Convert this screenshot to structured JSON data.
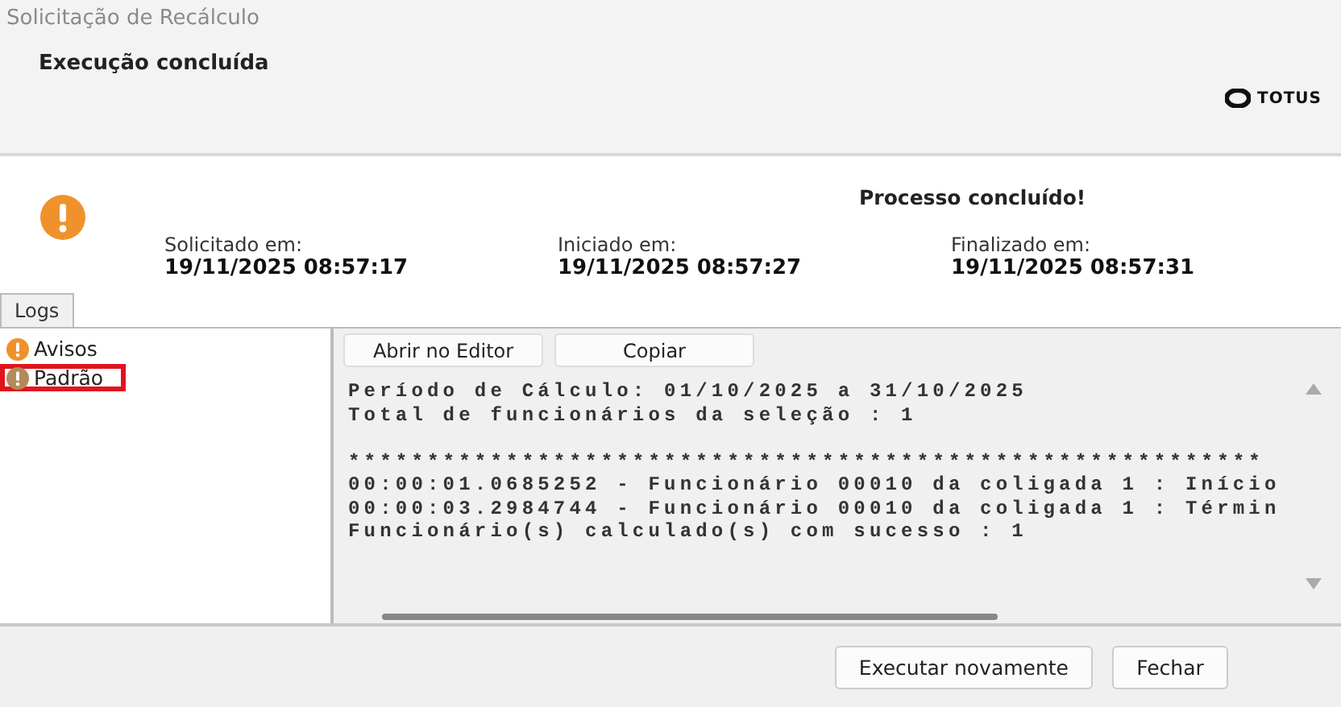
{
  "window": {
    "title": "Solicitação de Recálculo"
  },
  "header": {
    "heading": "Execução concluída",
    "logo": "TOTUS"
  },
  "summary": {
    "status": "Processo concluído!",
    "fields": [
      {
        "label": "Solicitado em:",
        "value": "19/11/2025 08:57:17"
      },
      {
        "label": "Iniciado em:",
        "value": "19/11/2025 08:57:27"
      },
      {
        "label": "Finalizado em:",
        "value": "19/11/2025 08:57:31"
      }
    ]
  },
  "tabs": [
    {
      "label": "Logs",
      "selected": true
    }
  ],
  "log_tree": [
    {
      "label": "Avisos",
      "kind": "warning",
      "marked": false
    },
    {
      "label": "Padrão",
      "kind": "default",
      "marked": true
    }
  ],
  "toolbar": [
    "Abrir no Editor",
    "Copiar"
  ],
  "log_lines": [
    {
      "text": "Período de Cálculo: 01/10/2025 a 31/10/2025",
      "gap_before": false
    },
    {
      "text": "Total de funcionários da seleção : 1",
      "gap_before": false
    },
    {
      "text": "**********************************************************",
      "gap_before": true
    },
    {
      "text": "00:00:01.0685252 - Funcionário 00010 da coligada 1 : Início",
      "gap_before": false
    },
    {
      "text": "00:00:03.2984744 - Funcionário 00010 da coligada 1 : Términ",
      "gap_before": false
    },
    {
      "text": "Funcionário(s) calculado(s) com sucesso : 1",
      "gap_before": false
    }
  ],
  "buttons": [
    "Executar novamente",
    "Fechar"
  ]
}
